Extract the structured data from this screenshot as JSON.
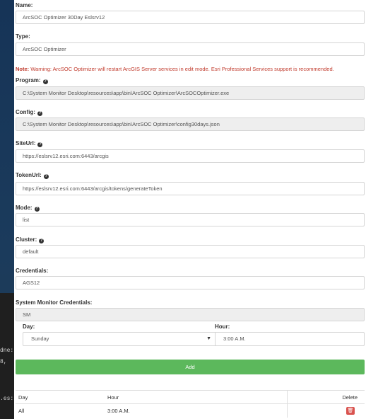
{
  "terminal": {
    "lines": [
      "dne:",
      " 8,",
      ".es:"
    ]
  },
  "form": {
    "name": {
      "label": "Name:",
      "value": "ArcSOC Optimizer 30Day Eslsrv12"
    },
    "type": {
      "label": "Type:",
      "value": "ArcSOC Optimizer"
    },
    "note": {
      "prefix": "Note:",
      "text": " Warning: ArcSOC Optimizer will restart ArcGIS Server services in edit mode. Esri Professional Services support is recommended."
    },
    "program": {
      "label": "Program:",
      "value": "C:\\System Monitor Desktop\\resources\\app\\bin\\ArcSOC Optimizer\\ArcSOCOptimizer.exe"
    },
    "config": {
      "label": "Config:",
      "value": "C:\\System Monitor Desktop\\resources\\app\\bin\\ArcSOC Optimizer\\config30days.json"
    },
    "siteurl": {
      "label": "SiteUrl:",
      "value": "https://eslsrv12.esri.com:6443/arcgis"
    },
    "tokenurl": {
      "label": "TokenUrl:",
      "value": "https://eslsrv12.esri.com:6443/arcgis/tokens/generateToken"
    },
    "mode": {
      "label": "Mode:",
      "value": "list"
    },
    "cluster": {
      "label": "Cluster:",
      "value": "default"
    },
    "credentials": {
      "label": "Credentials:",
      "value": "AGS12"
    },
    "sm_credentials": {
      "label": "System Monitor Credentials:",
      "value": "SM"
    }
  },
  "schedule": {
    "day_label": "Day:",
    "day_value": "Sunday",
    "hour_label": "Hour:",
    "hour_value": "3:00 A.M.",
    "add_label": "Add",
    "table": {
      "headers": [
        "Day",
        "Hour",
        "Delete"
      ],
      "rows": [
        {
          "day": "All",
          "hour": "3:00 A.M."
        }
      ]
    }
  },
  "icons": {
    "help": "question-circle-icon",
    "caret": "caret-down-icon",
    "trash": "trash-icon"
  },
  "colors": {
    "add_button": "#5cb85c",
    "delete_button": "#d9534f",
    "note_text": "#c0392b"
  }
}
